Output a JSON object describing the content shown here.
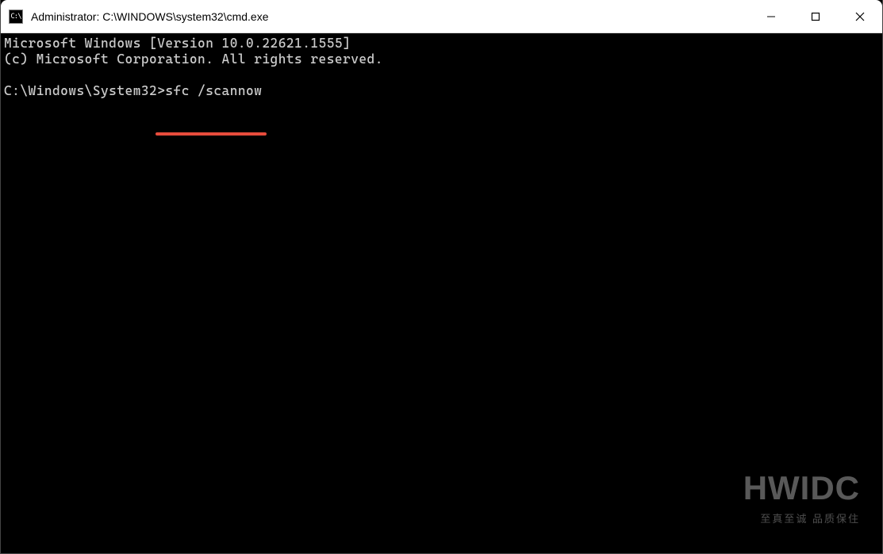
{
  "titlebar": {
    "icon_label": "C:\\",
    "title": "Administrator: C:\\WINDOWS\\system32\\cmd.exe"
  },
  "terminal": {
    "line1": "Microsoft Windows [Version 10.0.22621.1555]",
    "line2": "(c) Microsoft Corporation. All rights reserved.",
    "prompt": "C:\\Windows\\System32>",
    "command": "sfc /scannow"
  },
  "watermark": {
    "main": "HWIDC",
    "sub": "至真至诚 品质保住"
  },
  "annotation": {
    "underline_color": "#e74c3c"
  }
}
